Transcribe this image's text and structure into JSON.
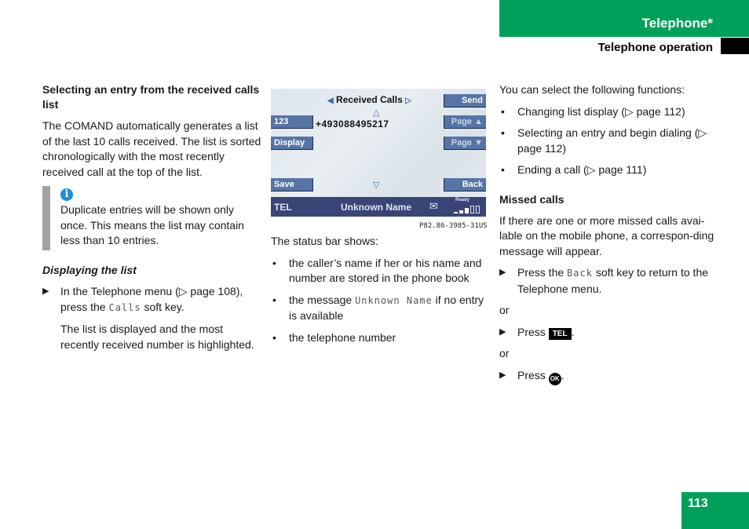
{
  "header": {
    "section_title": "Telephone*",
    "subsection": "Telephone operation"
  },
  "page_number": "113",
  "col1": {
    "heading": "Selecting an entry from the received calls list",
    "intro": "The COMAND automatically generates a list of the last 10 calls received. The list is sorted chronologically with the most recently received call at the top of the list.",
    "note_icon": "info-icon",
    "note_text": "Duplicate entries will be shown only once. This means the list may contain less than 10 entries.",
    "subheading": "Displaying the list",
    "step1_pre": "In the Telephone menu (▷ page 108), press the ",
    "step1_key": "Calls",
    "step1_post": " soft key.",
    "result": "The list is displayed and the most recently received number is highlighted."
  },
  "screen": {
    "title": "Received Calls",
    "left_arrow": "◀",
    "right_arrow": "▷",
    "up_arrow": "△",
    "down_arrow": "▽",
    "number": "+493088495217",
    "softkeys_left": [
      "123",
      "Display",
      "Save"
    ],
    "softkeys_right": [
      "Send",
      "Page ▲",
      "Page ▼",
      "Back"
    ],
    "status_tel": "TEL",
    "status_name": "Unknown Name",
    "status_envelope": "✉",
    "status_ready": "Ready",
    "signal_level": "3 of 5",
    "caption": "P82.86-3985-31US"
  },
  "col2": {
    "intro": "The status bar shows:",
    "b1": "the caller’s name if her or his name and number are stored in the phone book",
    "b2_pre": "the message ",
    "b2_key": "Unknown Name",
    "b2_post": " if no entry is available",
    "b3": "the telephone number"
  },
  "col3": {
    "intro": "You can select the following functions:",
    "b1": "Changing list display (▷ page 112)",
    "b2": "Selecting an entry and begin dialing (▷ page 112)",
    "b3": "Ending a call (▷ page 111)",
    "heading": "Missed calls",
    "missed_text": "If there are one or more missed calls avai-lable on the mobile phone, a correspon-ding message will appear.",
    "step1_pre": "Press the ",
    "step1_key": "Back",
    "step1_post": " soft key to return to the Telephone menu.",
    "or": "or",
    "press": "Press",
    "tel_key": "TEL",
    "ok_key": "OK"
  }
}
